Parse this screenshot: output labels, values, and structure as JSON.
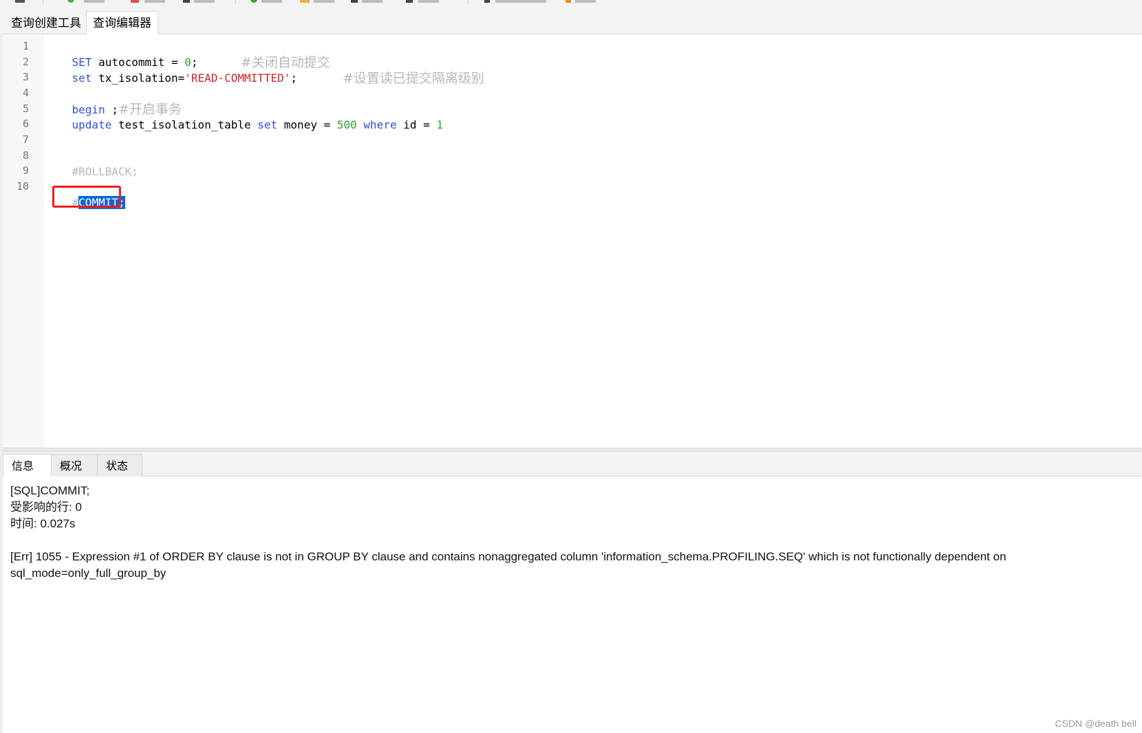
{
  "tabs": {
    "query_builder": "查询创建工具",
    "query_editor": "查询编辑器"
  },
  "editor": {
    "line_numbers": [
      "1",
      "2",
      "3",
      "4",
      "5",
      "6",
      "7",
      "8",
      "9",
      "10"
    ],
    "line1": {
      "kw": "SET",
      "text1": " autocommit = ",
      "num": "0",
      "text2": ";",
      "comment": "#关闭自动提交"
    },
    "line2": {
      "kw": "set",
      "text1": " tx_isolation=",
      "str": "'READ-COMMITTED'",
      "text2": ";",
      "comment": "#设置读已提交隔离级别"
    },
    "line4": {
      "kw": "begin",
      "text1": " ;",
      "comment": "#开启事务"
    },
    "line5": {
      "kw1": "update",
      "text1": " test_isolation_table ",
      "kw2": "set",
      "text2": " money = ",
      "num1": "500",
      "kw3": "where",
      "text3": " id = ",
      "num2": "1"
    },
    "line8": {
      "comment": "#ROLLBACK;"
    },
    "line10": {
      "hash": "#",
      "selected": "COMMIT;"
    }
  },
  "result_tabs": {
    "info": "信息",
    "overview": "概况",
    "status": "状态"
  },
  "messages": {
    "line1": "[SQL]COMMIT;",
    "line2": "受影响的行: 0",
    "line3": "时间: 0.027s",
    "line4": "[Err] 1055 - Expression #1 of ORDER BY clause is not in GROUP BY clause and contains nonaggregated column 'information_schema.PROFILING.SEQ' which is not functionally dependent on",
    "line5": "sql_mode=only_full_group_by"
  },
  "watermark": "CSDN @death bell"
}
